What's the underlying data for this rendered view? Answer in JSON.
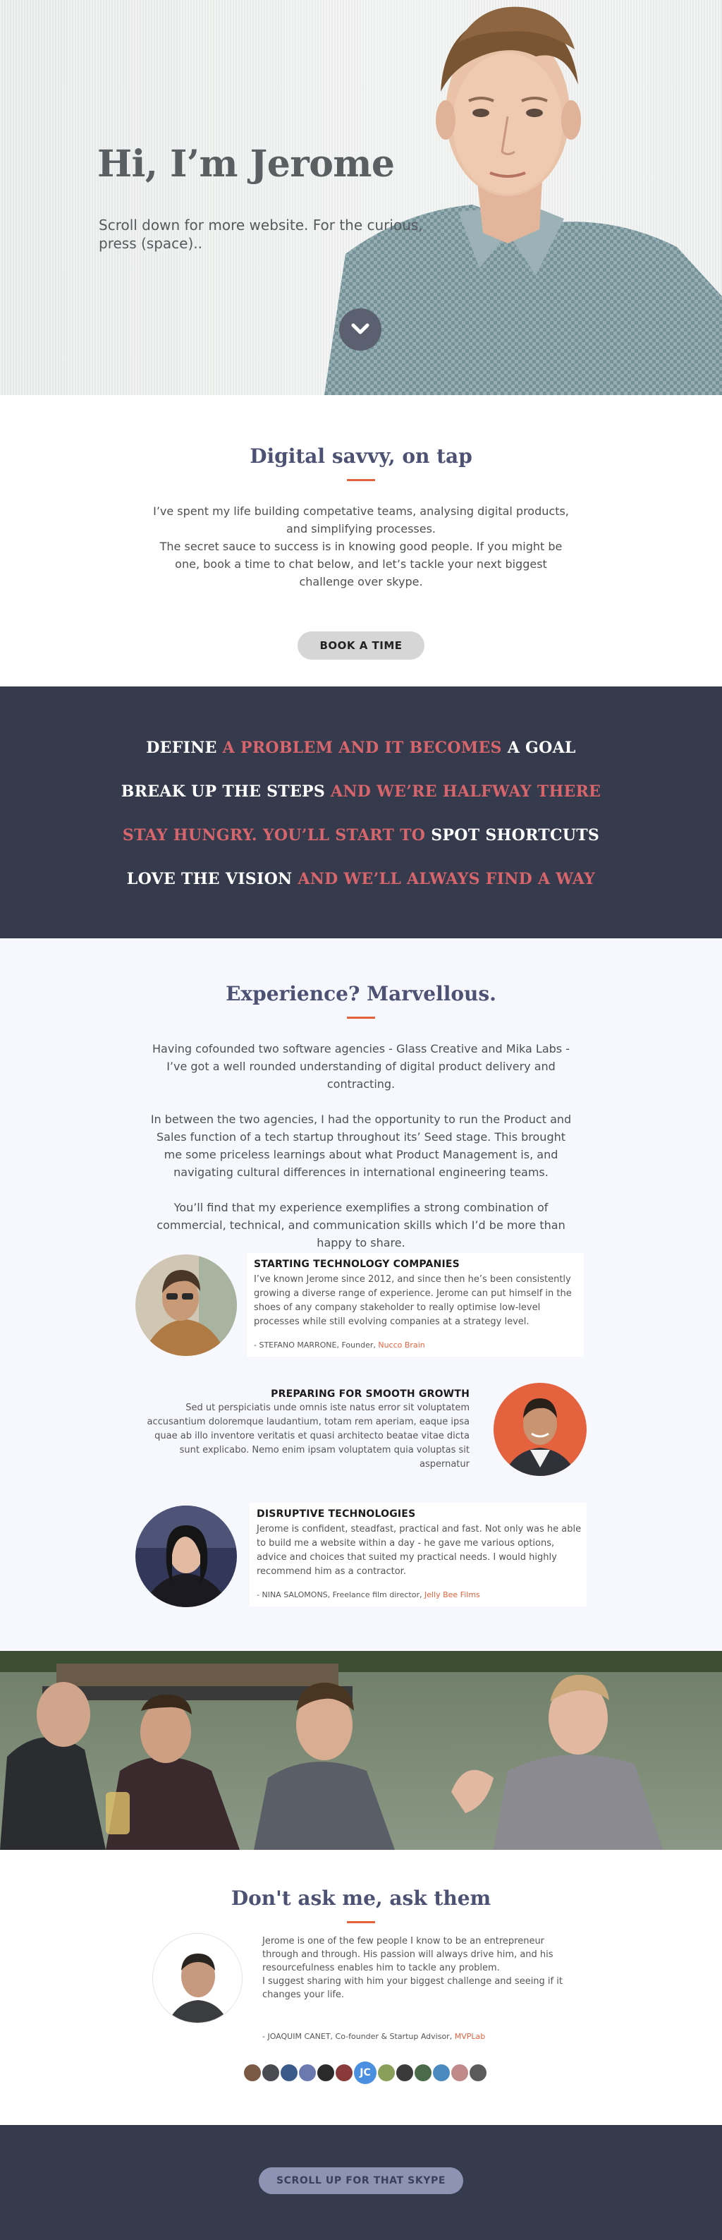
{
  "hero": {
    "title": "Hi, I’m Jerome",
    "subtitle": "Scroll down for more website. For the curious, press (space).."
  },
  "savvy": {
    "heading": "Digital savvy, on tap",
    "para1": "I’ve spent my life building competative teams, analysing digital products, and simplifying processes.",
    "para2": "The secret sauce to success is in knowing good people. If you might be one, book a time to chat below, and let’s tackle your next biggest challenge over skype.",
    "button": "BOOK A TIME"
  },
  "manifesto": {
    "line1": {
      "a": "DEFINE ",
      "b": "A PROBLEM AND IT BECOMES ",
      "c": "A GOAL"
    },
    "line2": {
      "a": "BREAK UP THE STEPS ",
      "b": "AND WE’RE HALFWAY THERE"
    },
    "line3": {
      "a": "STAY HUNGRY. YOU’LL START TO ",
      "b": "SPOT SHORTCUTS"
    },
    "line4": {
      "a": "LOVE THE VISION ",
      "b": "AND WE’LL ALWAYS FIND A WAY"
    }
  },
  "experience": {
    "heading": "Experience? Marvellous.",
    "para1": "Having cofounded two software agencies - Glass Creative and Mika Labs - I’ve got a well rounded understanding of digital product delivery and contracting.",
    "para2": "In between the two agencies, I had the opportunity to run the Product and Sales function of a tech startup throughout its’ Seed stage. This brought me some priceless learnings about what Product Management is, and navigating cultural differences in international engineering teams.",
    "para3": "You’ll find that my experience exemplifies a strong combination of commercial, technical, and communication skills which I’d be more than happy to share.",
    "testimonials": [
      {
        "title": "STARTING TECHNOLOGY COMPANIES",
        "text": "I’ve known Jerome since 2012, and since then he’s been consistently growing a diverse range of experience. Jerome can put himself in the shoes of any company stakeholder to really optimise low-level processes while still evolving companies at a strategy level.",
        "sig": "- STEFANO MARRONE, Founder, ",
        "company": "Nucco Brain"
      },
      {
        "title": "PREPARING FOR SMOOTH GROWTH",
        "text": "Sed ut perspiciatis unde omnis iste natus error sit voluptatem accusantium doloremque laudantium, totam rem aperiam, eaque ipsa quae ab illo inventore veritatis et quasi architecto beatae vitae dicta sunt explicabo. Nemo enim ipsam voluptatem quia voluptas sit aspernatur"
      },
      {
        "title": "DISRUPTIVE TECHNOLOGIES",
        "text": "Jerome is confident, steadfast, practical and fast. Not only was he able to build me a website within a day - he gave me various options, advice and choices that suited my practical needs. I would highly recommend him as a contractor.",
        "sig": "- NINA SALOMONS, Freelance film director, ",
        "company": "Jelly Bee Films"
      }
    ]
  },
  "ask": {
    "heading": "Don't ask me, ask them",
    "text1": "Jerome is one of the few people I know to be an entrepreneur through and through. His passion will always drive him, and his resourcefulness enables him to tackle any problem.",
    "text2": "I suggest sharing with him your biggest challenge and seeing if it changes your life.",
    "sig": "- JOAQUIM CANET, Co-founder & Startup Advisor, ",
    "company": "MVPLab",
    "active_initials": "JC"
  },
  "footer": {
    "button": "SCROLL UP FOR THAT SKYPE"
  },
  "colors": {
    "accent": "#e5623f",
    "navy": "#353a4c",
    "manifesto_red": "#d6656c",
    "heading": "#4d5173"
  }
}
